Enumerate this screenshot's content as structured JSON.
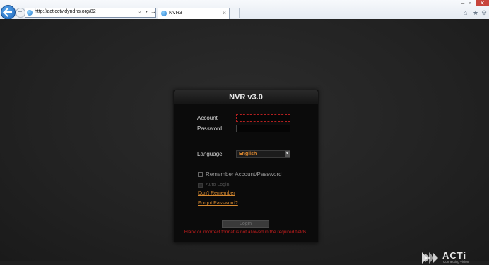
{
  "browser": {
    "url": "http://acticctv.dyndns.org/82",
    "tab_title": "NVR3",
    "tab_close": "×",
    "search_glyph": "⌕",
    "dropdown_glyph": "▾",
    "go_glyph": "→",
    "minimize": "–",
    "maximize": "▫",
    "close": "✕",
    "home_icon": "⌂",
    "favorites_icon": "★",
    "tools_icon": "⚙"
  },
  "login": {
    "title": "NVR v3.0",
    "account_label": "Account",
    "account_value": "",
    "password_label": "Password",
    "password_value": "",
    "language_label": "Language",
    "language_value": "English",
    "language_arrow": "▼",
    "remember_label": "Remember Account/Password",
    "auto_login_label": "Auto Login",
    "dont_remember_link": "Don't Remember",
    "forgot_password_link": "Forgot Password?",
    "login_button": "Login",
    "error_message": "Blank or incorrect format is not allowed in the required fields."
  },
  "logo": {
    "name": "ACTi",
    "tagline": "Connecting Vision"
  },
  "colors": {
    "accent": "#d88a30",
    "error": "#c81e1e",
    "background": "#222222"
  }
}
